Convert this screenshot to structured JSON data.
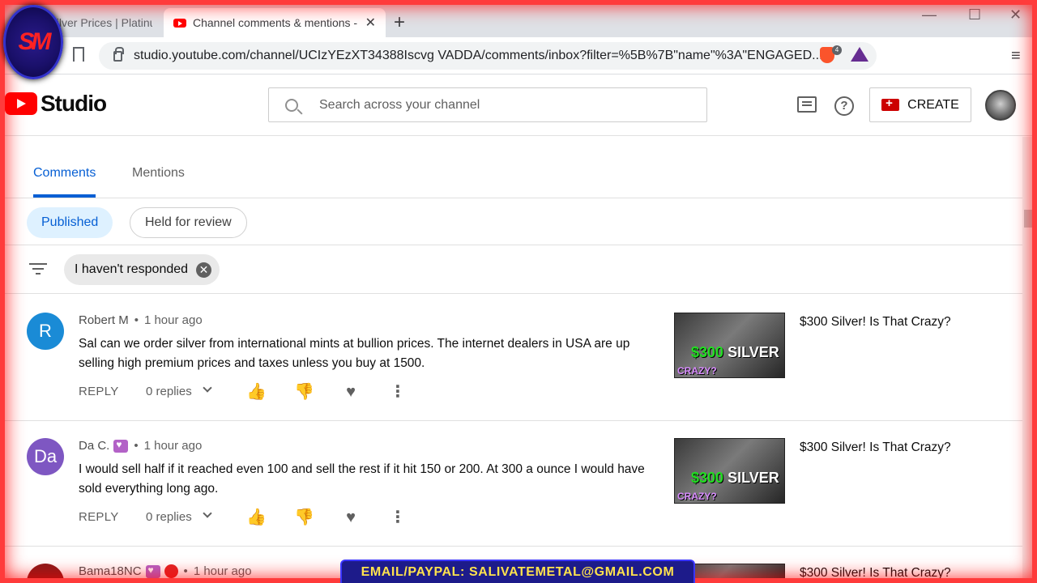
{
  "browser": {
    "tabs": [
      {
        "title": "s | Silver Prices | Platinu"
      },
      {
        "title": "Channel comments & mentions -"
      }
    ],
    "url": "studio.youtube.com/channel/UCIzYEzXT34388Iscvg VADDA/comments/inbox?filter=%5B%7B\"name\"%3A\"ENGAGED...",
    "extension_badge": "4"
  },
  "header": {
    "logo_text": "Studio",
    "search_placeholder": "Search across your channel",
    "create_label": "CREATE"
  },
  "tabs": {
    "comments": "Comments",
    "mentions": "Mentions"
  },
  "chips": {
    "published": "Published",
    "held": "Held for review"
  },
  "filter": {
    "chip_label": "I haven't responded"
  },
  "comments": [
    {
      "avatar_letter": "R",
      "avatar_color": "#1a8bd6",
      "author": "Robert M",
      "time": "1 hour ago",
      "text": "Sal can we order silver from international mints at bullion prices. The internet dealers in USA are up selling high premium prices and taxes unless you buy at 1500.",
      "reply_label": "REPLY",
      "replies": "0 replies",
      "video_title": "$300 Silver! Is That Crazy?",
      "thumb_price": "$300",
      "thumb_word": "SILVER",
      "thumb_tag": "CRAZY?"
    },
    {
      "avatar_letter": "Da",
      "avatar_color": "#7e57c2",
      "author": "Da C.",
      "time": "1 hour ago",
      "text": "I would sell half if it reached even 100 and sell the rest if it hit 150 or 200.  At 300 a ounce I would have sold everything long ago.",
      "reply_label": "REPLY",
      "replies": "0 replies",
      "video_title": "$300 Silver! Is That Crazy?",
      "thumb_price": "$300",
      "thumb_word": "SILVER",
      "thumb_tag": "CRAZY?"
    },
    {
      "author": "Bama18NC",
      "time": "1 hour ago",
      "video_title": "$300 Silver! Is That Crazy?"
    }
  ],
  "overlay": {
    "corner_logo": "SM",
    "banner": "EMAIL/PAYPAL: SALIVATEMETAL@GMAIL.COM"
  }
}
